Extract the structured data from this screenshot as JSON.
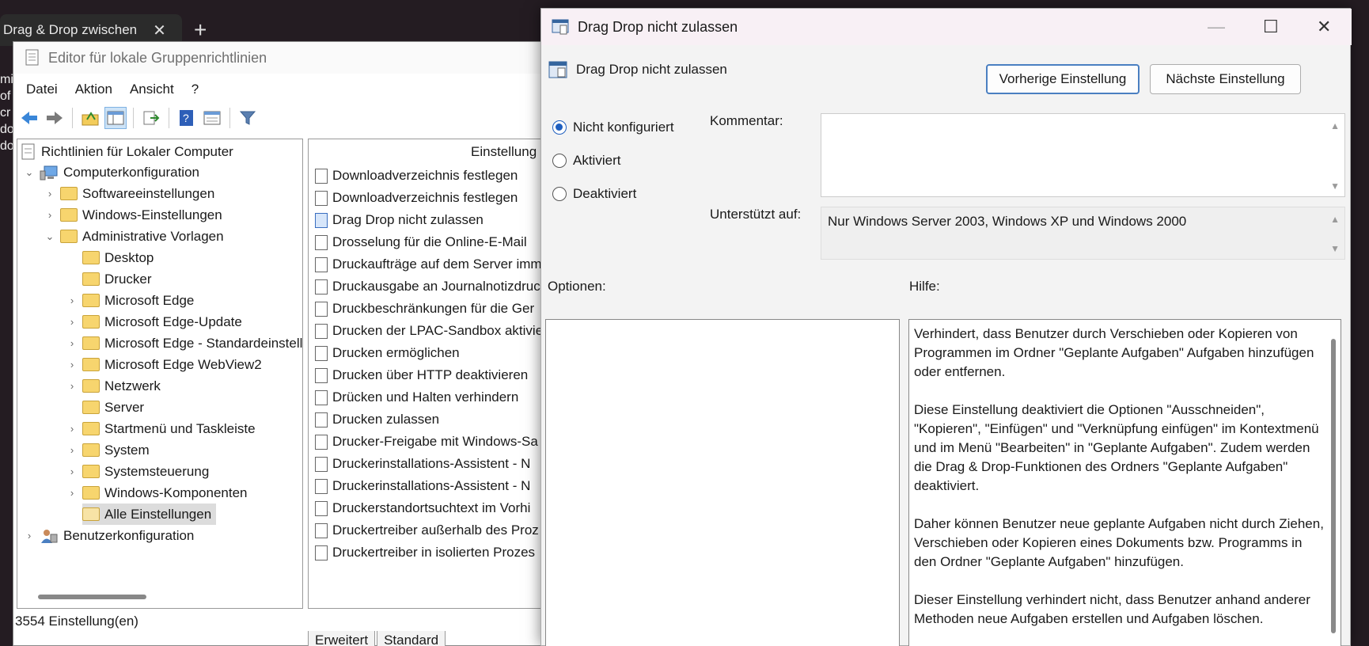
{
  "browser": {
    "tab_title": "Drag & Drop zwischen",
    "close": "✕",
    "new_tab": "+",
    "peek": [
      "mi",
      "of",
      "cr",
      "",
      "do",
      "",
      "do"
    ]
  },
  "gpe": {
    "title": "Editor für lokale Gruppenrichtlinien",
    "menu": [
      "Datei",
      "Aktion",
      "Ansicht",
      "?"
    ],
    "tree": {
      "root": "Richtlinien für Lokaler Computer",
      "computer": "Computerkonfiguration",
      "software": "Softwareeinstellungen",
      "windows": "Windows-Einstellungen",
      "admin": "Administrative Vorlagen",
      "items": [
        "Desktop",
        "Drucker",
        "Microsoft Edge",
        "Microsoft Edge-Update",
        "Microsoft Edge - Standardeinstellungen",
        "Microsoft Edge WebView2",
        "Netzwerk",
        "Server",
        "Startmenü und Taskleiste",
        "System",
        "Systemsteuerung",
        "Windows-Komponenten",
        "Alle Einstellungen"
      ],
      "user": "Benutzerkonfiguration"
    },
    "list_header": "Einstellung",
    "list_rows": [
      "Downloadverzeichnis festlegen",
      "Downloadverzeichnis festlegen",
      "Drag  Drop nicht zulassen",
      "Drosselung für die Online-E-Mail",
      "Druckaufträge auf dem Server imm",
      "Druckausgabe an Journalnotizdruc",
      "Druckbeschränkungen für die Ger",
      "Drucken der LPAC-Sandbox aktivie",
      "Drucken ermöglichen",
      "Drucken über HTTP deaktivieren",
      "Drücken und Halten verhindern",
      "Drucken zulassen",
      "Drucker-Freigabe mit Windows-Sa",
      "Druckerinstallations-Assistent - N",
      "Druckerinstallations-Assistent - N",
      "Druckerstandortsuchtext im Vorhi",
      "Druckertreiber außerhalb des Proz",
      "Druckertreiber in isolierten Prozes"
    ],
    "tabs": [
      "Erweitert",
      "Standard"
    ],
    "status": "3554 Einstellung(en)"
  },
  "dialog": {
    "title": "Drag  Drop nicht zulassen",
    "heading": "Drag  Drop nicht zulassen",
    "minimize": "—",
    "maximize": "☐",
    "close": "✕",
    "prev_button": "Vorherige Einstellung",
    "next_button": "Nächste Einstellung",
    "radios": [
      "Nicht konfiguriert",
      "Aktiviert",
      "Deaktiviert"
    ],
    "comment_label": "Kommentar:",
    "supported_label": "Unterstützt auf:",
    "supported_value": "Nur Windows Server 2003, Windows XP und Windows 2000",
    "options_label": "Optionen:",
    "help_label": "Hilfe:",
    "help_paragraphs": [
      "Verhindert, dass Benutzer durch Verschieben oder Kopieren von Programmen im Ordner \"Geplante Aufgaben\" Aufgaben hinzufügen oder entfernen.",
      "Diese Einstellung deaktiviert die Optionen \"Ausschneiden\", \"Kopieren\", \"Einfügen\" und \"Verknüpfung einfügen\" im Kontextmenü und im Menü \"Bearbeiten\" in \"Geplante Aufgaben\". Zudem werden die Drag & Drop-Funktionen des Ordners \"Geplante Aufgaben\" deaktiviert.",
      "Daher können Benutzer neue geplante Aufgaben nicht durch Ziehen, Verschieben oder Kopieren eines Dokuments bzw. Programms in den Ordner \"Geplante Aufgaben\" hinzufügen.",
      "Dieser Einstellung verhindert nicht, dass Benutzer anhand anderer Methoden neue Aufgaben erstellen und Aufgaben löschen."
    ]
  }
}
